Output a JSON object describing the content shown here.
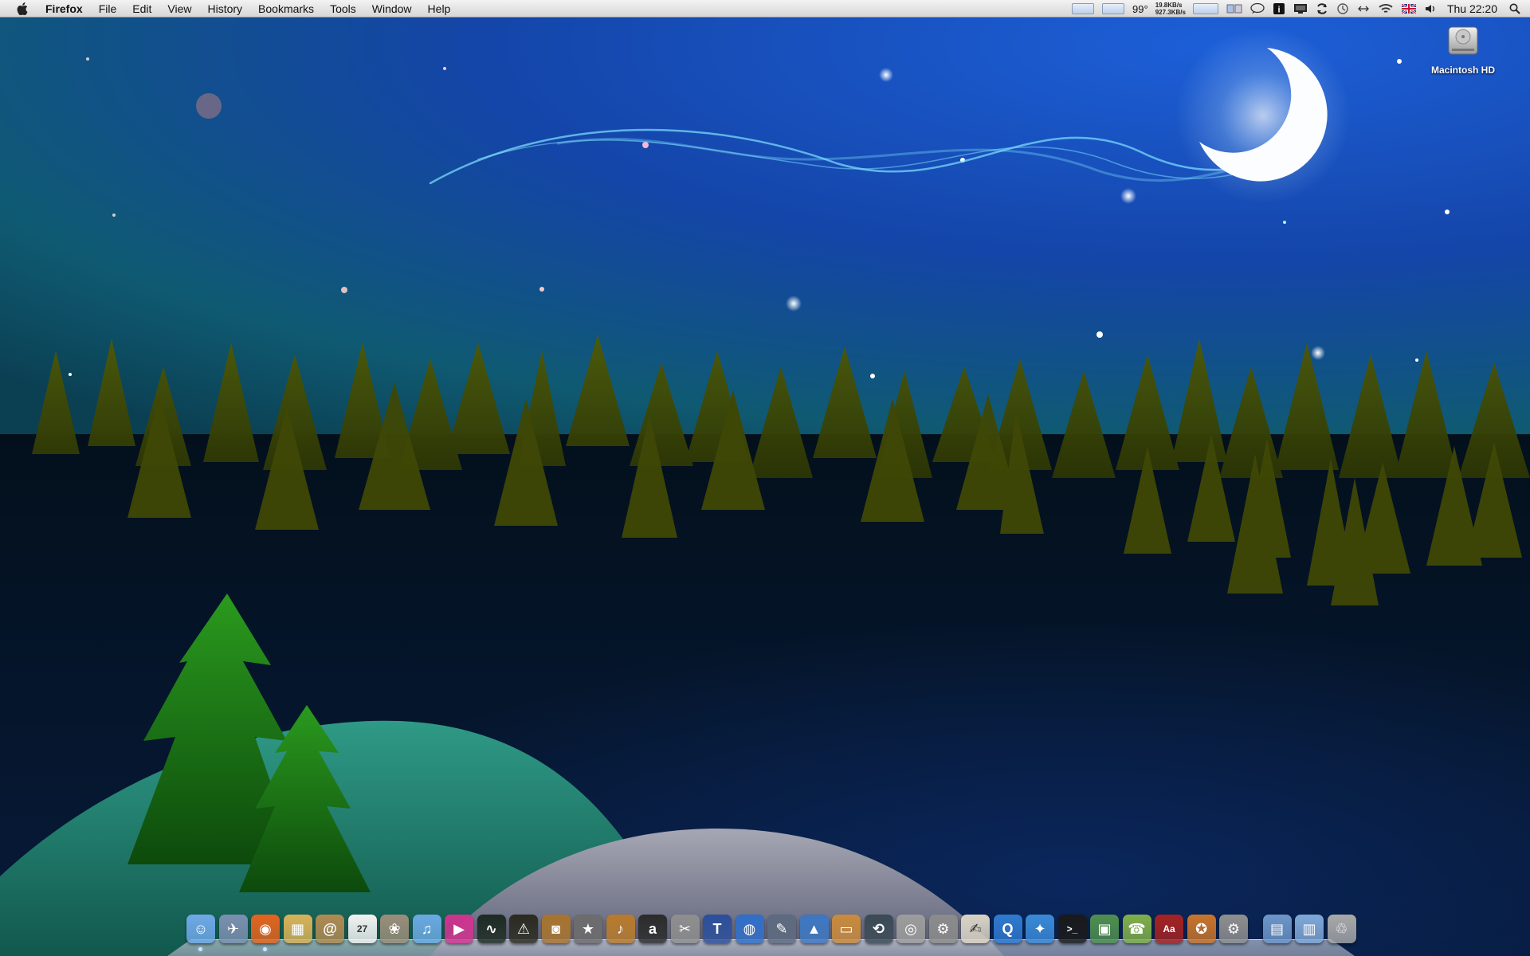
{
  "menubar": {
    "app_name": "Firefox",
    "menus": [
      "File",
      "Edit",
      "View",
      "History",
      "Bookmarks",
      "Tools",
      "Window",
      "Help"
    ],
    "status": {
      "temperature": "99°",
      "net_up": "19.8KB/s",
      "net_down": "927.3KB/s",
      "clock": "Thu 22:20"
    }
  },
  "desktop": {
    "icons": [
      {
        "label": "Macintosh HD",
        "icon": "hard-drive-icon"
      }
    ]
  },
  "dock": {
    "apps": [
      {
        "name": "finder-icon",
        "bg": "#6fa8e8",
        "glyph": "☺",
        "running": true
      },
      {
        "name": "mail-icon",
        "bg": "#7b8fb0",
        "glyph": "✈",
        "running": false
      },
      {
        "name": "firefox-icon",
        "bg": "#e4631d",
        "glyph": "◉",
        "running": true
      },
      {
        "name": "preview-icon",
        "bg": "#d8b25a",
        "glyph": "▦",
        "running": false
      },
      {
        "name": "address-book-icon",
        "bg": "#b08a52",
        "glyph": "@",
        "running": false
      },
      {
        "name": "ical-icon",
        "bg": "#f2f2f2",
        "glyph": "27",
        "running": false
      },
      {
        "name": "iphoto-icon",
        "bg": "#9a8d7a",
        "glyph": "❀",
        "running": false
      },
      {
        "name": "itunes-icon",
        "bg": "#6aa9e3",
        "glyph": "♫",
        "running": false
      },
      {
        "name": "media-player-icon",
        "bg": "#d0338f",
        "glyph": "▶",
        "running": false
      },
      {
        "name": "activity-monitor-icon",
        "bg": "#1c2a22",
        "glyph": "∿",
        "running": false
      },
      {
        "name": "console-icon",
        "bg": "#2a2a20",
        "glyph": "⚠",
        "running": false
      },
      {
        "name": "image-capture-icon",
        "bg": "#a8742e",
        "glyph": "◙",
        "running": false
      },
      {
        "name": "imovie-icon",
        "bg": "#6c6c6c",
        "glyph": "★",
        "running": false
      },
      {
        "name": "garageband-icon",
        "bg": "#b87a2c",
        "glyph": "♪",
        "running": false
      },
      {
        "name": "amazon-icon",
        "bg": "#2b2b2b",
        "glyph": "a",
        "running": false
      },
      {
        "name": "final-cut-icon",
        "bg": "#8e8e8e",
        "glyph": "✂",
        "running": false
      },
      {
        "name": "idvd-icon",
        "bg": "#2c4f9a",
        "glyph": "T",
        "running": false
      },
      {
        "name": "google-earth-icon",
        "bg": "#2f6fc8",
        "glyph": "◍",
        "running": false
      },
      {
        "name": "script-editor-icon",
        "bg": "#5d6a80",
        "glyph": "✎",
        "running": false
      },
      {
        "name": "grapher-icon",
        "bg": "#3d77c2",
        "glyph": "▲",
        "running": false
      },
      {
        "name": "keynote-icon",
        "bg": "#c98a3c",
        "glyph": "▭",
        "running": false
      },
      {
        "name": "time-machine-icon",
        "bg": "#3a4a55",
        "glyph": "⟲",
        "running": false
      },
      {
        "name": "disk-utility-icon",
        "bg": "#9c9c9c",
        "glyph": "◎",
        "running": false
      },
      {
        "name": "system-profiler-icon",
        "bg": "#8b8b8b",
        "glyph": "⚙",
        "running": false
      },
      {
        "name": "textedit-icon",
        "bg": "#d9d3c4",
        "glyph": "✍",
        "running": false
      },
      {
        "name": "quicktime-icon",
        "bg": "#2f7ad0",
        "glyph": "Q",
        "running": false
      },
      {
        "name": "safari-icon",
        "bg": "#3a8ad8",
        "glyph": "✦",
        "running": false
      },
      {
        "name": "terminal-icon",
        "bg": "#1a1a1a",
        "glyph": ">_",
        "running": false
      },
      {
        "name": "screen-sharing-icon",
        "bg": "#4f8f4f",
        "glyph": "▣",
        "running": false
      },
      {
        "name": "ichat-icon",
        "bg": "#7fb04a",
        "glyph": "☎",
        "running": false
      },
      {
        "name": "dictionary-icon",
        "bg": "#a52222",
        "glyph": "Aa",
        "running": false
      },
      {
        "name": "front-row-icon",
        "bg": "#c9742a",
        "glyph": "✪",
        "running": false
      },
      {
        "name": "system-preferences-icon",
        "bg": "#8f8f8f",
        "glyph": "⚙",
        "running": false
      }
    ],
    "stacks": [
      {
        "name": "applications-stack-icon",
        "bg": "#6d96c9",
        "glyph": "▤"
      },
      {
        "name": "documents-stack-icon",
        "bg": "#7fa8d8",
        "glyph": "▥"
      },
      {
        "name": "trash-icon",
        "bg": "#a9a9a9",
        "glyph": "♲"
      }
    ]
  }
}
